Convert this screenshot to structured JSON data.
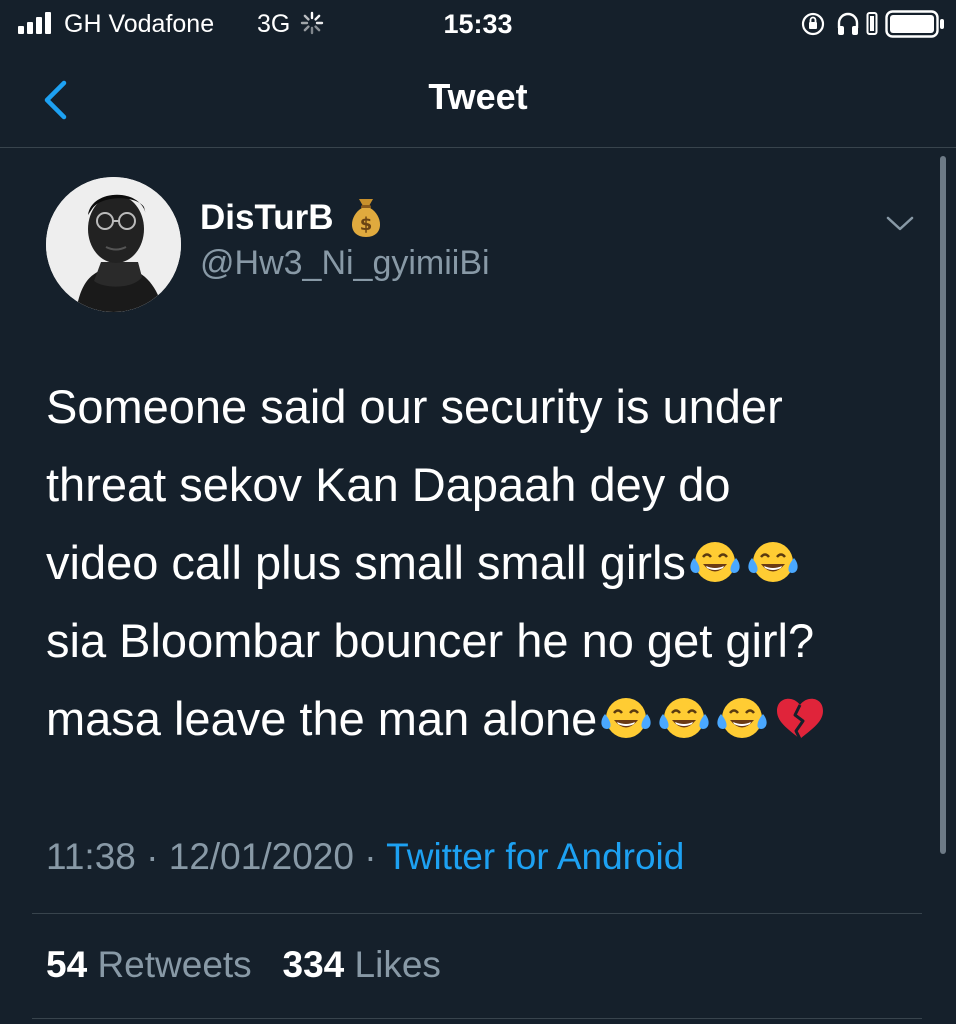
{
  "status_bar": {
    "carrier": "GH Vodafone",
    "network": "3G",
    "time": "15:33"
  },
  "nav": {
    "title": "Tweet",
    "back_icon": "chevron-left-icon"
  },
  "tweet": {
    "author": {
      "display_name": "DisTurB",
      "name_emoji": "money-bag-icon",
      "handle": "@Hw3_Ni_gyimiiBi"
    },
    "text_lines": [
      "Someone said our security is under",
      "threat sekov Kan Dapaah dey do",
      "video call plus small small girls",
      "sia Bloombar bouncer he no get girl?",
      "masa leave the man alone"
    ],
    "emoji": {
      "line3": [
        "face-with-tears-of-joy",
        "face-with-tears-of-joy"
      ],
      "line5": [
        "face-with-tears-of-joy",
        "face-with-tears-of-joy",
        "face-with-tears-of-joy",
        "broken-heart"
      ]
    },
    "meta": {
      "time": "11:38",
      "date": "12/01/2020",
      "separator": "·",
      "source": "Twitter for Android"
    },
    "stats": {
      "retweets_count": "54",
      "retweets_label": "Retweets",
      "likes_count": "334",
      "likes_label": "Likes"
    }
  },
  "colors": {
    "background": "#15202b",
    "text": "#ffffff",
    "secondary_text": "#8899a6",
    "accent": "#1da1f2",
    "divider": "#38444d"
  }
}
